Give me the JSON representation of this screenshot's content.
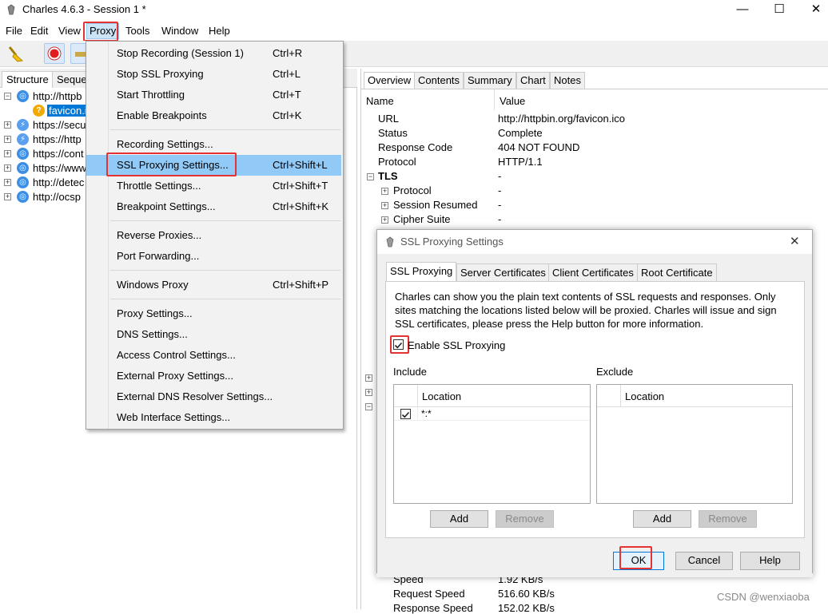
{
  "window": {
    "title": "Charles 4.6.3 - Session 1 *",
    "minimize": "—",
    "maximize": "☐",
    "close": "✕"
  },
  "menubar": [
    "File",
    "Edit",
    "View",
    "Proxy",
    "Tools",
    "Window",
    "Help"
  ],
  "left_tabs": [
    "Structure",
    "Seque"
  ],
  "tree": [
    {
      "label": "http://httpb",
      "exp": "⊟",
      "icon": "globe"
    },
    {
      "label": "favicon.i",
      "icon": "question",
      "selected": true
    },
    {
      "label": "https://secu",
      "exp": "⊞",
      "icon": "bolt"
    },
    {
      "label": "https://http",
      "exp": "⊞",
      "icon": "bolt"
    },
    {
      "label": "https://cont",
      "exp": "⊞",
      "icon": "globe"
    },
    {
      "label": "https://www",
      "exp": "⊞",
      "icon": "globe"
    },
    {
      "label": "http://detec",
      "exp": "⊞",
      "icon": "globe"
    },
    {
      "label": "http://ocsp",
      "exp": "⊞",
      "icon": "globe"
    }
  ],
  "right_tabs": [
    "Overview",
    "Contents",
    "Summary",
    "Chart",
    "Notes"
  ],
  "overview": {
    "col_name": "Name",
    "col_value": "Value",
    "rows": [
      {
        "k": "URL",
        "v": "http://httpbin.org/favicon.ico"
      },
      {
        "k": "Status",
        "v": "Complete"
      },
      {
        "k": "Response Code",
        "v": "404 NOT FOUND"
      },
      {
        "k": "Protocol",
        "v": "HTTP/1.1"
      }
    ],
    "tls": {
      "k": "TLS",
      "v": "-"
    },
    "tls_rows": [
      {
        "k": "Protocol",
        "v": "-"
      },
      {
        "k": "Session Resumed",
        "v": "-"
      },
      {
        "k": "Cipher Suite",
        "v": "-"
      }
    ],
    "bottom_rows": [
      {
        "k": "Speed",
        "v": "1.92 KB/s"
      },
      {
        "k": "Request Speed",
        "v": "516.60 KB/s"
      },
      {
        "k": "Response Speed",
        "v": "152.02 KB/s"
      }
    ]
  },
  "proxy_menu": [
    {
      "label": "Stop Recording (Session 1)",
      "shortcut": "Ctrl+R"
    },
    {
      "label": "Stop SSL Proxying",
      "shortcut": "Ctrl+L"
    },
    {
      "label": "Start Throttling",
      "shortcut": "Ctrl+T"
    },
    {
      "label": "Enable Breakpoints",
      "shortcut": "Ctrl+K"
    },
    {
      "sep": true
    },
    {
      "label": "Recording Settings...",
      "shortcut": ""
    },
    {
      "label": "SSL Proxying Settings...",
      "shortcut": "Ctrl+Shift+L",
      "highlight": true
    },
    {
      "label": "Throttle Settings...",
      "shortcut": "Ctrl+Shift+T"
    },
    {
      "label": "Breakpoint Settings...",
      "shortcut": "Ctrl+Shift+K"
    },
    {
      "sep": true
    },
    {
      "label": "Reverse Proxies...",
      "shortcut": ""
    },
    {
      "label": "Port Forwarding...",
      "shortcut": ""
    },
    {
      "sep": true
    },
    {
      "label": "Windows Proxy",
      "shortcut": "Ctrl+Shift+P"
    },
    {
      "sep": true
    },
    {
      "label": "Proxy Settings...",
      "shortcut": ""
    },
    {
      "label": "DNS Settings...",
      "shortcut": ""
    },
    {
      "label": "Access Control Settings...",
      "shortcut": ""
    },
    {
      "label": "External Proxy Settings...",
      "shortcut": ""
    },
    {
      "label": "External DNS Resolver Settings...",
      "shortcut": ""
    },
    {
      "label": "Web Interface Settings...",
      "shortcut": ""
    }
  ],
  "dialog": {
    "title": "SSL Proxying Settings",
    "close": "✕",
    "tabs": [
      "SSL Proxying",
      "Server Certificates",
      "Client Certificates",
      "Root Certificate"
    ],
    "description_lines": [
      "Charles can show you the plain text contents of SSL requests and responses. Only",
      "sites matching the locations listed below will be proxied. Charles will issue and sign",
      "SSL certificates, please press the Help button for more information."
    ],
    "enable_label": "Enable SSL Proxying",
    "enable_checked": true,
    "include": {
      "title": "Include",
      "col": "Location",
      "rows": [
        {
          "checked": true,
          "location": "*:*"
        }
      ],
      "add": "Add",
      "remove": "Remove"
    },
    "exclude": {
      "title": "Exclude",
      "col": "Location",
      "rows": [],
      "add": "Add",
      "remove": "Remove"
    },
    "ok": "OK",
    "cancel": "Cancel",
    "help": "Help"
  },
  "watermark": "CSDN @wenxiaoba",
  "colors": {
    "highlight": "#91c9f7",
    "annotation_red": "#e53333",
    "link_blue": "#3a8ee6"
  }
}
